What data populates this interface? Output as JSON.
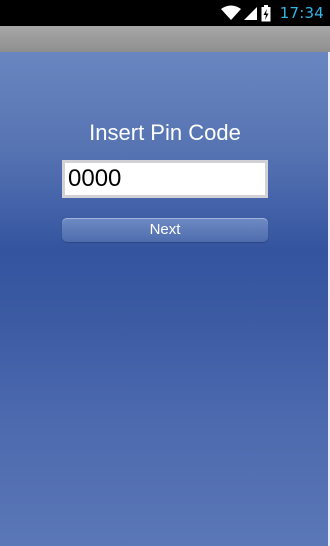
{
  "status_bar": {
    "time": "17:34",
    "icons": [
      "wifi-icon",
      "signal-icon",
      "battery-charging-icon"
    ],
    "time_color": "#33b5e5"
  },
  "pin_screen": {
    "prompt": "Insert Pin Code",
    "pin_value": "0000",
    "next_label": "Next"
  },
  "colors": {
    "background_top": "#6a86c0",
    "background_mid": "#3454a0",
    "title_bar": "#9a9a9a",
    "button": "#5a78b8"
  }
}
